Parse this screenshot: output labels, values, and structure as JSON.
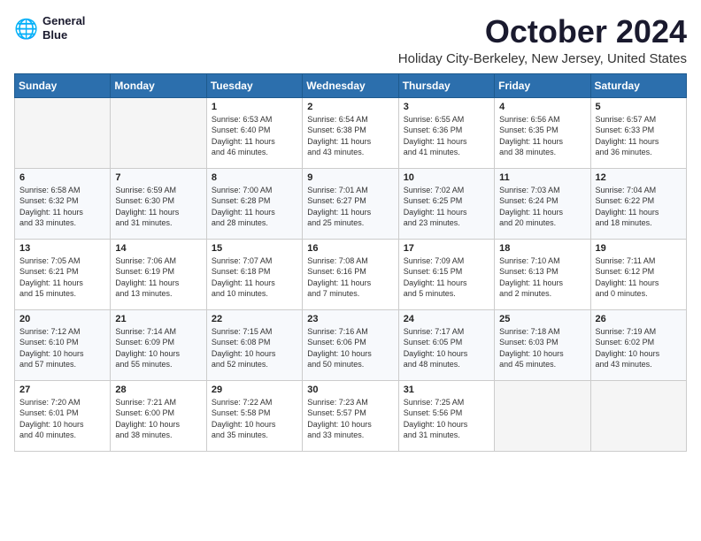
{
  "header": {
    "logo_line1": "General",
    "logo_line2": "Blue",
    "month_title": "October 2024",
    "location": "Holiday City-Berkeley, New Jersey, United States"
  },
  "calendar": {
    "weekdays": [
      "Sunday",
      "Monday",
      "Tuesday",
      "Wednesday",
      "Thursday",
      "Friday",
      "Saturday"
    ],
    "weeks": [
      [
        {
          "day": "",
          "info": ""
        },
        {
          "day": "",
          "info": ""
        },
        {
          "day": "1",
          "info": "Sunrise: 6:53 AM\nSunset: 6:40 PM\nDaylight: 11 hours\nand 46 minutes."
        },
        {
          "day": "2",
          "info": "Sunrise: 6:54 AM\nSunset: 6:38 PM\nDaylight: 11 hours\nand 43 minutes."
        },
        {
          "day": "3",
          "info": "Sunrise: 6:55 AM\nSunset: 6:36 PM\nDaylight: 11 hours\nand 41 minutes."
        },
        {
          "day": "4",
          "info": "Sunrise: 6:56 AM\nSunset: 6:35 PM\nDaylight: 11 hours\nand 38 minutes."
        },
        {
          "day": "5",
          "info": "Sunrise: 6:57 AM\nSunset: 6:33 PM\nDaylight: 11 hours\nand 36 minutes."
        }
      ],
      [
        {
          "day": "6",
          "info": "Sunrise: 6:58 AM\nSunset: 6:32 PM\nDaylight: 11 hours\nand 33 minutes."
        },
        {
          "day": "7",
          "info": "Sunrise: 6:59 AM\nSunset: 6:30 PM\nDaylight: 11 hours\nand 31 minutes."
        },
        {
          "day": "8",
          "info": "Sunrise: 7:00 AM\nSunset: 6:28 PM\nDaylight: 11 hours\nand 28 minutes."
        },
        {
          "day": "9",
          "info": "Sunrise: 7:01 AM\nSunset: 6:27 PM\nDaylight: 11 hours\nand 25 minutes."
        },
        {
          "day": "10",
          "info": "Sunrise: 7:02 AM\nSunset: 6:25 PM\nDaylight: 11 hours\nand 23 minutes."
        },
        {
          "day": "11",
          "info": "Sunrise: 7:03 AM\nSunset: 6:24 PM\nDaylight: 11 hours\nand 20 minutes."
        },
        {
          "day": "12",
          "info": "Sunrise: 7:04 AM\nSunset: 6:22 PM\nDaylight: 11 hours\nand 18 minutes."
        }
      ],
      [
        {
          "day": "13",
          "info": "Sunrise: 7:05 AM\nSunset: 6:21 PM\nDaylight: 11 hours\nand 15 minutes."
        },
        {
          "day": "14",
          "info": "Sunrise: 7:06 AM\nSunset: 6:19 PM\nDaylight: 11 hours\nand 13 minutes."
        },
        {
          "day": "15",
          "info": "Sunrise: 7:07 AM\nSunset: 6:18 PM\nDaylight: 11 hours\nand 10 minutes."
        },
        {
          "day": "16",
          "info": "Sunrise: 7:08 AM\nSunset: 6:16 PM\nDaylight: 11 hours\nand 7 minutes."
        },
        {
          "day": "17",
          "info": "Sunrise: 7:09 AM\nSunset: 6:15 PM\nDaylight: 11 hours\nand 5 minutes."
        },
        {
          "day": "18",
          "info": "Sunrise: 7:10 AM\nSunset: 6:13 PM\nDaylight: 11 hours\nand 2 minutes."
        },
        {
          "day": "19",
          "info": "Sunrise: 7:11 AM\nSunset: 6:12 PM\nDaylight: 11 hours\nand 0 minutes."
        }
      ],
      [
        {
          "day": "20",
          "info": "Sunrise: 7:12 AM\nSunset: 6:10 PM\nDaylight: 10 hours\nand 57 minutes."
        },
        {
          "day": "21",
          "info": "Sunrise: 7:14 AM\nSunset: 6:09 PM\nDaylight: 10 hours\nand 55 minutes."
        },
        {
          "day": "22",
          "info": "Sunrise: 7:15 AM\nSunset: 6:08 PM\nDaylight: 10 hours\nand 52 minutes."
        },
        {
          "day": "23",
          "info": "Sunrise: 7:16 AM\nSunset: 6:06 PM\nDaylight: 10 hours\nand 50 minutes."
        },
        {
          "day": "24",
          "info": "Sunrise: 7:17 AM\nSunset: 6:05 PM\nDaylight: 10 hours\nand 48 minutes."
        },
        {
          "day": "25",
          "info": "Sunrise: 7:18 AM\nSunset: 6:03 PM\nDaylight: 10 hours\nand 45 minutes."
        },
        {
          "day": "26",
          "info": "Sunrise: 7:19 AM\nSunset: 6:02 PM\nDaylight: 10 hours\nand 43 minutes."
        }
      ],
      [
        {
          "day": "27",
          "info": "Sunrise: 7:20 AM\nSunset: 6:01 PM\nDaylight: 10 hours\nand 40 minutes."
        },
        {
          "day": "28",
          "info": "Sunrise: 7:21 AM\nSunset: 6:00 PM\nDaylight: 10 hours\nand 38 minutes."
        },
        {
          "day": "29",
          "info": "Sunrise: 7:22 AM\nSunset: 5:58 PM\nDaylight: 10 hours\nand 35 minutes."
        },
        {
          "day": "30",
          "info": "Sunrise: 7:23 AM\nSunset: 5:57 PM\nDaylight: 10 hours\nand 33 minutes."
        },
        {
          "day": "31",
          "info": "Sunrise: 7:25 AM\nSunset: 5:56 PM\nDaylight: 10 hours\nand 31 minutes."
        },
        {
          "day": "",
          "info": ""
        },
        {
          "day": "",
          "info": ""
        }
      ]
    ]
  }
}
